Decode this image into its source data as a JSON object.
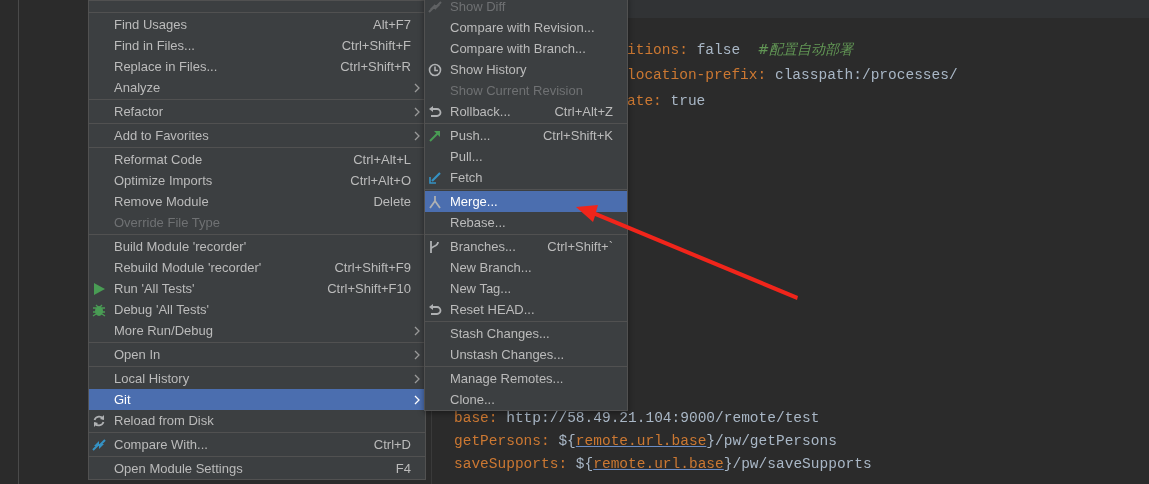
{
  "editor": {
    "top_lines": [
      {
        "key": "itions:",
        "value": "false",
        "comment": "#配置自动部署"
      },
      {
        "key": "location-prefix:",
        "value": "classpath:/processes/"
      },
      {
        "key": "ate:",
        "value": "true"
      }
    ],
    "bottom_lines": [
      {
        "key": "base:",
        "parts": [
          {
            "kind": "plain",
            "text": "http://58.49.21.104:9000/remote/test"
          }
        ]
      },
      {
        "key": "getPersons:",
        "parts": [
          {
            "kind": "plain",
            "text": "${"
          },
          {
            "kind": "ref",
            "text": "remote.url.base"
          },
          {
            "kind": "plain",
            "text": "}/pw/getPersons"
          }
        ]
      },
      {
        "key": "saveSupports:",
        "parts": [
          {
            "kind": "plain",
            "text": "${"
          },
          {
            "kind": "ref",
            "text": "remote.url.base"
          },
          {
            "kind": "plain",
            "text": "}/pw/saveSupports"
          }
        ]
      }
    ]
  },
  "context_menu": {
    "items": [
      {
        "kind": "separator"
      },
      {
        "kind": "item",
        "label": "Find Usages",
        "shortcut": "Alt+F7",
        "submenu": false,
        "disabled": false,
        "selected": false
      },
      {
        "kind": "item",
        "label": "Find in Files...",
        "shortcut": "Ctrl+Shift+F",
        "submenu": false,
        "disabled": false,
        "selected": false
      },
      {
        "kind": "item",
        "label": "Replace in Files...",
        "shortcut": "Ctrl+Shift+R",
        "submenu": false,
        "disabled": false,
        "selected": false
      },
      {
        "kind": "item",
        "label": "Analyze",
        "submenu": true,
        "disabled": false,
        "selected": false
      },
      {
        "kind": "separator"
      },
      {
        "kind": "item",
        "label": "Refactor",
        "submenu": true,
        "disabled": false,
        "selected": false
      },
      {
        "kind": "separator"
      },
      {
        "kind": "item",
        "label": "Add to Favorites",
        "submenu": true,
        "disabled": false,
        "selected": false
      },
      {
        "kind": "separator"
      },
      {
        "kind": "item",
        "label": "Reformat Code",
        "shortcut": "Ctrl+Alt+L",
        "submenu": false,
        "disabled": false,
        "selected": false
      },
      {
        "kind": "item",
        "label": "Optimize Imports",
        "shortcut": "Ctrl+Alt+O",
        "submenu": false,
        "disabled": false,
        "selected": false
      },
      {
        "kind": "item",
        "label": "Remove Module",
        "shortcut": "Delete",
        "submenu": false,
        "disabled": false,
        "selected": false
      },
      {
        "kind": "item",
        "label": "Override File Type",
        "submenu": false,
        "disabled": true,
        "selected": false
      },
      {
        "kind": "separator"
      },
      {
        "kind": "item",
        "label": "Build Module 'recorder'",
        "submenu": false,
        "disabled": false,
        "selected": false
      },
      {
        "kind": "item",
        "label": "Rebuild Module 'recorder'",
        "shortcut": "Ctrl+Shift+F9",
        "submenu": false,
        "disabled": false,
        "selected": false
      },
      {
        "kind": "item",
        "label": "Run 'All Tests'",
        "shortcut": "Ctrl+Shift+F10",
        "submenu": false,
        "disabled": false,
        "selected": false
      },
      {
        "kind": "item",
        "label": "Debug 'All Tests'",
        "submenu": false,
        "disabled": false,
        "selected": false
      },
      {
        "kind": "item",
        "label": "More Run/Debug",
        "submenu": true,
        "disabled": false,
        "selected": false
      },
      {
        "kind": "separator"
      },
      {
        "kind": "item",
        "label": "Open In",
        "submenu": true,
        "disabled": false,
        "selected": false
      },
      {
        "kind": "separator"
      },
      {
        "kind": "item",
        "label": "Local History",
        "submenu": true,
        "disabled": false,
        "selected": false
      },
      {
        "kind": "item",
        "label": "Git",
        "submenu": true,
        "disabled": false,
        "selected": true
      },
      {
        "kind": "item",
        "label": "Reload from Disk",
        "submenu": false,
        "disabled": false,
        "selected": false
      },
      {
        "kind": "separator"
      },
      {
        "kind": "item",
        "label": "Compare With...",
        "shortcut": "Ctrl+D",
        "submenu": false,
        "disabled": false,
        "selected": false
      },
      {
        "kind": "separator"
      },
      {
        "kind": "item",
        "label": "Open Module Settings",
        "shortcut": "F4",
        "submenu": false,
        "disabled": false,
        "selected": false
      }
    ]
  },
  "git_submenu": {
    "items": [
      {
        "kind": "item",
        "label": "Show Diff",
        "submenu": false,
        "disabled": true,
        "selected": false
      },
      {
        "kind": "item",
        "label": "Compare with Revision...",
        "submenu": false,
        "disabled": false,
        "selected": false
      },
      {
        "kind": "item",
        "label": "Compare with Branch...",
        "submenu": false,
        "disabled": false,
        "selected": false
      },
      {
        "kind": "item",
        "label": "Show History",
        "submenu": false,
        "disabled": false,
        "selected": false
      },
      {
        "kind": "item",
        "label": "Show Current Revision",
        "submenu": false,
        "disabled": true,
        "selected": false
      },
      {
        "kind": "item",
        "label": "Rollback...",
        "shortcut": "Ctrl+Alt+Z",
        "submenu": false,
        "disabled": false,
        "selected": false
      },
      {
        "kind": "separator"
      },
      {
        "kind": "item",
        "label": "Push...",
        "shortcut": "Ctrl+Shift+K",
        "submenu": false,
        "disabled": false,
        "selected": false
      },
      {
        "kind": "item",
        "label": "Pull...",
        "submenu": false,
        "disabled": false,
        "selected": false
      },
      {
        "kind": "item",
        "label": "Fetch",
        "submenu": false,
        "disabled": false,
        "selected": false
      },
      {
        "kind": "separator"
      },
      {
        "kind": "item",
        "label": "Merge...",
        "submenu": false,
        "disabled": false,
        "selected": true
      },
      {
        "kind": "item",
        "label": "Rebase...",
        "submenu": false,
        "disabled": false,
        "selected": false
      },
      {
        "kind": "separator"
      },
      {
        "kind": "item",
        "label": "Branches...",
        "shortcut": "Ctrl+Shift+`",
        "submenu": false,
        "disabled": false,
        "selected": false
      },
      {
        "kind": "item",
        "label": "New Branch...",
        "submenu": false,
        "disabled": false,
        "selected": false
      },
      {
        "kind": "item",
        "label": "New Tag...",
        "submenu": false,
        "disabled": false,
        "selected": false
      },
      {
        "kind": "item",
        "label": "Reset HEAD...",
        "submenu": false,
        "disabled": false,
        "selected": false
      },
      {
        "kind": "separator"
      },
      {
        "kind": "item",
        "label": "Stash Changes...",
        "submenu": false,
        "disabled": false,
        "selected": false
      },
      {
        "kind": "item",
        "label": "Unstash Changes...",
        "submenu": false,
        "disabled": false,
        "selected": false
      },
      {
        "kind": "separator"
      },
      {
        "kind": "item",
        "label": "Manage Remotes...",
        "submenu": false,
        "disabled": false,
        "selected": false
      },
      {
        "kind": "item",
        "label": "Clone...",
        "submenu": false,
        "disabled": false,
        "selected": false
      }
    ]
  }
}
